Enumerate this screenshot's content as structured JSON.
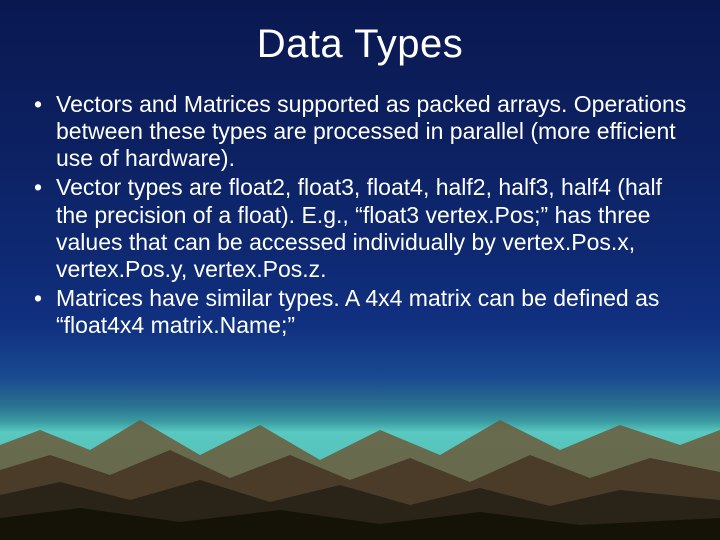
{
  "slide": {
    "title": "Data Types",
    "bullets": [
      "Vectors and Matrices supported as packed arrays. Operations between these types are processed in parallel (more efficient use of hardware).",
      "Vector types are float2, float3, float4, half2, half3, half4 (half the precision of a float).  E.g., “float3 vertex.Pos;” has three values that can be accessed individually by vertex.Pos.x, vertex.Pos.y, vertex.Pos.z.",
      "Matrices have similar types.  A 4x4 matrix can be defined as “float4x4 matrix.Name;”"
    ]
  }
}
